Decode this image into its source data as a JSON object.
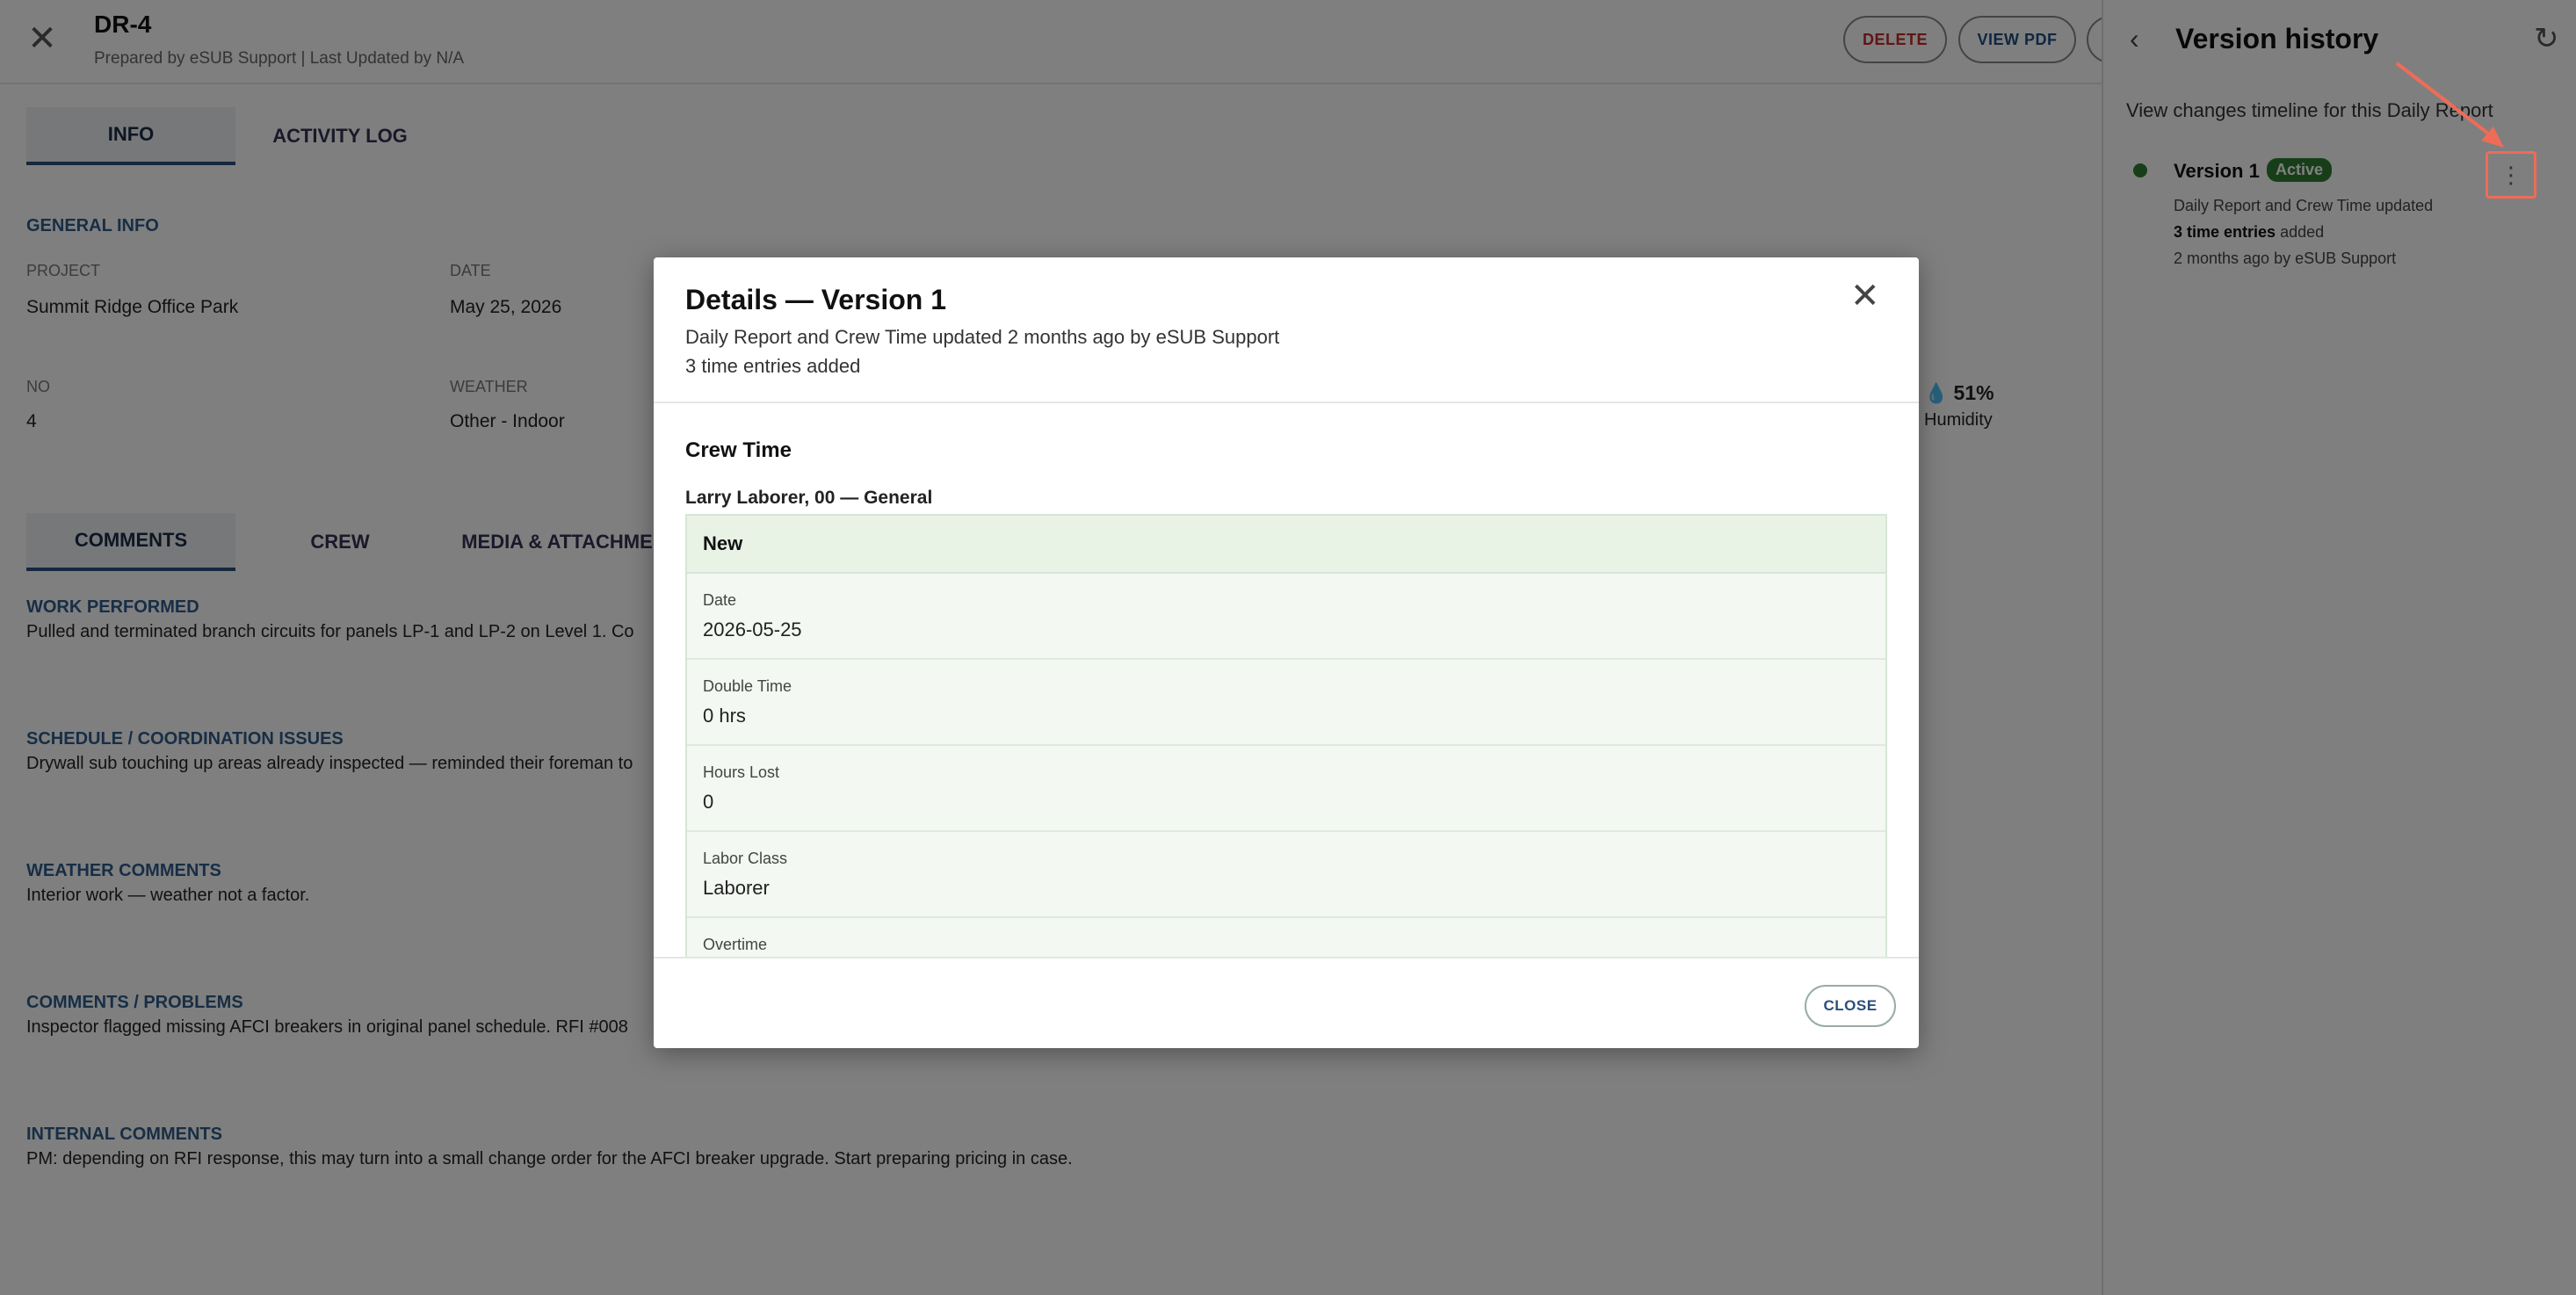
{
  "header": {
    "title": "DR-4",
    "subtitle": "Prepared by eSUB Support | Last Updated by N/A",
    "delete_label": "DELETE",
    "view_pdf_label": "VIEW PDF"
  },
  "top_tabs": [
    "INFO",
    "ACTIVITY LOG"
  ],
  "general_info": {
    "heading": "GENERAL INFO",
    "project_label": "PROJECT",
    "project_value": "Summit Ridge Office Park",
    "date_label": "DATE",
    "date_value": "May 25, 2026",
    "no_label": "NO",
    "no_value": "4",
    "weather_label": "WEATHER",
    "weather_value": "Other - Indoor",
    "humidity_value": "51%",
    "humidity_label": "Humidity"
  },
  "bottom_tabs": [
    "COMMENTS",
    "CREW",
    "MEDIA & ATTACHMENTS"
  ],
  "comments": [
    {
      "heading": "WORK PERFORMED",
      "text": "Pulled and terminated branch circuits for panels LP-1 and LP-2 on Level 1. Co"
    },
    {
      "heading": "SCHEDULE / COORDINATION ISSUES",
      "text": "Drywall sub touching up areas already inspected — reminded their foreman to"
    },
    {
      "heading": "WEATHER COMMENTS",
      "text": "Interior work — weather not a factor."
    },
    {
      "heading": "COMMENTS / PROBLEMS",
      "text": "Inspector flagged missing AFCI breakers in original panel schedule. RFI #008"
    },
    {
      "heading": "INTERNAL COMMENTS",
      "text": "PM: depending on RFI response, this may turn into a small change order for the AFCI breaker upgrade. Start preparing pricing in case."
    }
  ],
  "version_panel": {
    "title": "Version history",
    "description": "View changes timeline for this Daily Report",
    "version_name": "Version 1",
    "badge": "Active",
    "line1": "Daily Report and Crew Time updated",
    "line2_bold": "3 time entries",
    "line2_rest": " added",
    "line3": "2 months ago by eSUB Support"
  },
  "modal": {
    "title": "Details — Version 1",
    "subtitle1": "Daily Report and Crew Time updated 2 months ago by eSUB Support",
    "subtitle2": "3 time entries added",
    "section": "Crew Time",
    "person": "Larry Laborer, 00 — General",
    "entry_status": "New",
    "fields": [
      {
        "label": "Date",
        "value": "2026-05-25"
      },
      {
        "label": "Double Time",
        "value": "0 hrs"
      },
      {
        "label": "Hours Lost",
        "value": "0"
      },
      {
        "label": "Labor Class",
        "value": "Laborer"
      },
      {
        "label": "Overtime",
        "value": ""
      }
    ],
    "close_label": "CLOSE"
  },
  "colors": {
    "accent": "#2e5c8a",
    "active_green": "#2e7d32",
    "delete_red": "#c62828",
    "highlight": "#ef6c57"
  }
}
